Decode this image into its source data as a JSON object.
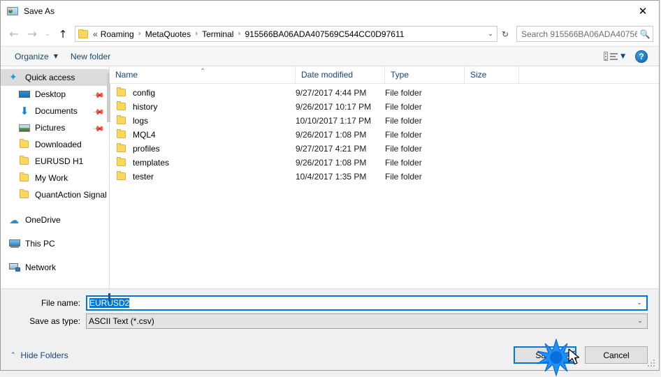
{
  "window": {
    "title": "Save As",
    "title_icon": "save-as-icon",
    "close_label": "✕"
  },
  "navigation": {
    "back_icon": "←",
    "forward_icon": "→",
    "recent_icon": "⌄",
    "up_icon": "↑",
    "refresh_icon": "↻",
    "folder_icon": "folder-icon",
    "breadcrumb_prefix": "«",
    "breadcrumbs": [
      "Roaming",
      "MetaQuotes",
      "Terminal",
      "915566BA06ADA407569C544CC0D97611"
    ],
    "separator": "›",
    "dropdown_icon": "⌄"
  },
  "search": {
    "placeholder": "Search 915566BA06ADA40756...",
    "icon": "search-icon"
  },
  "toolbar": {
    "organize_label": "Organize",
    "organize_caret": "▼",
    "new_folder_label": "New folder",
    "view_icon": "view-list-icon",
    "view_caret": "▼",
    "help_icon": "help-icon",
    "help_label": "?"
  },
  "sidebar": {
    "items": [
      {
        "label": "Quick access",
        "icon": "star-icon",
        "selected": true,
        "indent": false,
        "pinned": false
      },
      {
        "label": "Desktop",
        "icon": "desktop-icon",
        "selected": false,
        "indent": true,
        "pinned": true
      },
      {
        "label": "Documents",
        "icon": "download-arrow-icon",
        "selected": false,
        "indent": true,
        "pinned": true
      },
      {
        "label": "Pictures",
        "icon": "pictures-icon",
        "selected": false,
        "indent": true,
        "pinned": true
      },
      {
        "label": "Downloaded",
        "icon": "folder-icon",
        "selected": false,
        "indent": true,
        "pinned": false
      },
      {
        "label": "EURUSD H1",
        "icon": "folder-icon",
        "selected": false,
        "indent": true,
        "pinned": false
      },
      {
        "label": "My Work",
        "icon": "folder-icon",
        "selected": false,
        "indent": true,
        "pinned": false
      },
      {
        "label": "QuantAction Signal",
        "icon": "folder-icon",
        "selected": false,
        "indent": true,
        "pinned": false
      },
      {
        "label": "OneDrive",
        "icon": "cloud-icon",
        "selected": false,
        "indent": false,
        "pinned": false
      },
      {
        "label": "This PC",
        "icon": "computer-icon",
        "selected": false,
        "indent": false,
        "pinned": false
      },
      {
        "label": "Network",
        "icon": "network-icon",
        "selected": false,
        "indent": false,
        "pinned": false
      }
    ]
  },
  "filelist": {
    "columns": [
      "Name",
      "Date modified",
      "Type",
      "Size"
    ],
    "sort_caret": "⌃",
    "rows": [
      {
        "name": "config",
        "date": "9/27/2017 4:44 PM",
        "type": "File folder",
        "size": ""
      },
      {
        "name": "history",
        "date": "9/26/2017 10:17 PM",
        "type": "File folder",
        "size": ""
      },
      {
        "name": "logs",
        "date": "10/10/2017 1:17 PM",
        "type": "File folder",
        "size": ""
      },
      {
        "name": "MQL4",
        "date": "9/26/2017 1:08 PM",
        "type": "File folder",
        "size": ""
      },
      {
        "name": "profiles",
        "date": "9/27/2017 4:21 PM",
        "type": "File folder",
        "size": ""
      },
      {
        "name": "templates",
        "date": "9/26/2017 1:08 PM",
        "type": "File folder",
        "size": ""
      },
      {
        "name": "tester",
        "date": "10/4/2017 1:35 PM",
        "type": "File folder",
        "size": ""
      }
    ]
  },
  "form": {
    "filename_label": "File name:",
    "filename_value": "EURUSD2",
    "filetype_label": "Save as type:",
    "filetype_value": "ASCII Text (*.csv)",
    "dropdown_icon": "⌄"
  },
  "footer": {
    "hide_folders_label": "Hide Folders",
    "hide_folders_caret": "⌃",
    "save_label": "Save",
    "cancel_label": "Cancel"
  },
  "colors": {
    "accent": "#0078d7",
    "link_text": "#15457a",
    "folder_yellow": "#ffd75e",
    "selection_blue": "#0078d7",
    "selected_row_gray": "#dcdcdc"
  }
}
